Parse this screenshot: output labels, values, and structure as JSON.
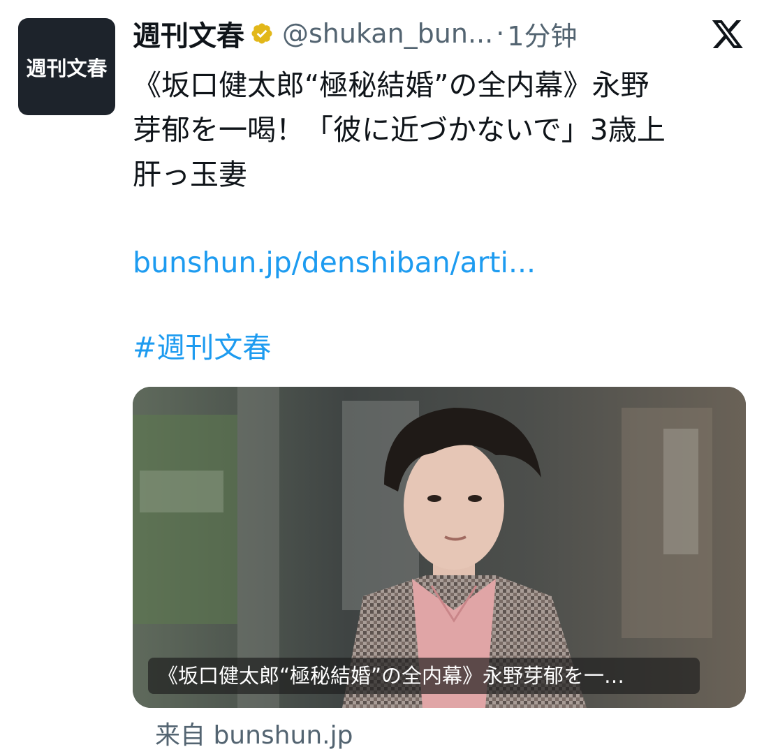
{
  "account": {
    "avatar_text": "週刊文春",
    "display_name": "週刊文春",
    "handle": "@shukan_bun...",
    "separator": "·",
    "time": "1分钟"
  },
  "icons": {
    "verified": "verified-badge-icon",
    "platform": "x-logo-icon"
  },
  "tweet": {
    "lines": [
      "《坂口健太郎“極秘結婚”の全内幕》永野",
      "芽郁を一喝！「彼に近づかないで」3歳上",
      "肝っ玉妻"
    ],
    "link": "bunshun.jp/denshiban/arti...",
    "hashtag": "#週刊文春"
  },
  "card": {
    "caption": "《坂口健太郎“極秘結婚”の全内幕》永野芽郁を一…",
    "source": "来自 bunshun.jp"
  },
  "colors": {
    "link": "#1d9bf0",
    "secondary_text": "#536471",
    "verified_gold": "#e2b719",
    "avatar_bg": "#1d232b"
  }
}
